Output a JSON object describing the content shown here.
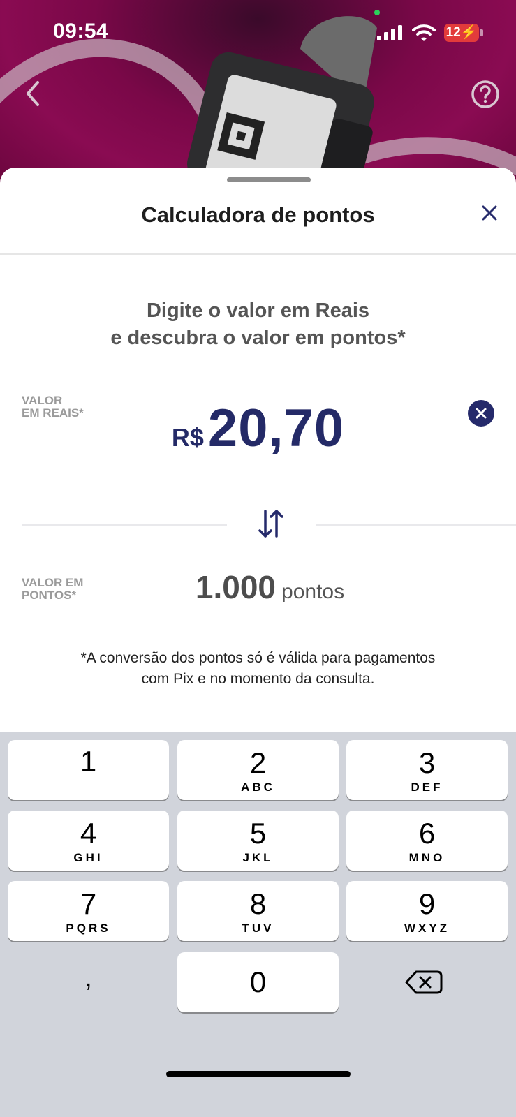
{
  "status_bar": {
    "time": "09:54",
    "battery": "12"
  },
  "nav": {
    "back_icon": "chevron-left-icon",
    "help_icon": "question-circle-icon"
  },
  "sheet": {
    "title": "Calculadora de pontos",
    "close_icon": "close-icon",
    "instruction_line1": "Digite o valor em Reais",
    "instruction_line2": "e descubra o valor em pontos*",
    "reais_label_line1": "VALOR",
    "reais_label_line2": "EM REAIS*",
    "currency": "R$",
    "amount": "20,70",
    "pontos_label_line1": "VALOR EM",
    "pontos_label_line2": "PONTOS*",
    "points_value": "1.000",
    "points_unit": "pontos",
    "disclaimer_line1": "*A conversão dos pontos só é válida para pagamentos",
    "disclaimer_line2": "com Pix e no momento da consulta."
  },
  "keyboard": {
    "keys": [
      {
        "digit": "1",
        "letters": ""
      },
      {
        "digit": "2",
        "letters": "ABC"
      },
      {
        "digit": "3",
        "letters": "DEF"
      },
      {
        "digit": "4",
        "letters": "GHI"
      },
      {
        "digit": "5",
        "letters": "JKL"
      },
      {
        "digit": "6",
        "letters": "MNO"
      },
      {
        "digit": "7",
        "letters": "PQRS"
      },
      {
        "digit": "8",
        "letters": "TUV"
      },
      {
        "digit": "9",
        "letters": "WXYZ"
      },
      {
        "digit": "0",
        "letters": ""
      }
    ],
    "comma": ",",
    "delete_icon": "backspace-icon"
  },
  "colors": {
    "brand_navy": "#252a6b",
    "hero_magenta": "#8a0b52"
  }
}
